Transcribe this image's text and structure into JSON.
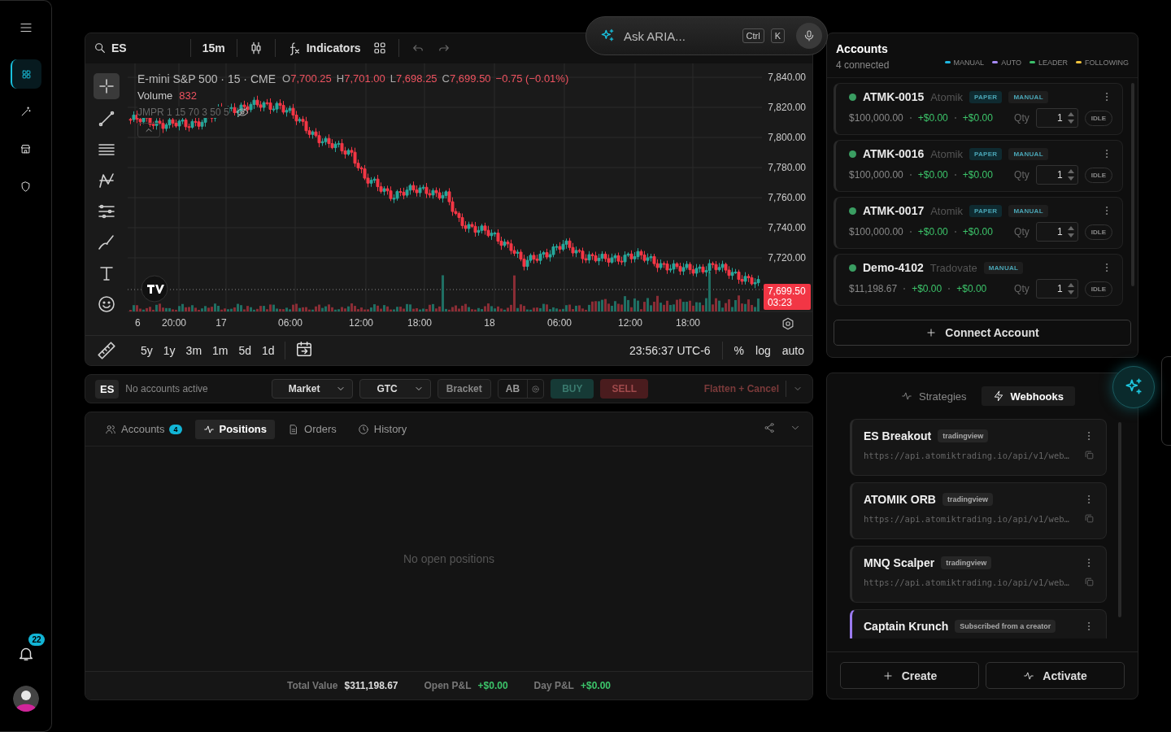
{
  "sidebar": {
    "items": [
      {
        "kind": "grid",
        "selected": true
      },
      {
        "kind": "wand",
        "selected": false
      },
      {
        "kind": "store",
        "selected": false
      },
      {
        "kind": "shield",
        "selected": false
      }
    ],
    "notifications": "22"
  },
  "aria": {
    "placeholder": "Ask ARIA...",
    "keys": [
      "Ctrl",
      "K"
    ]
  },
  "chart": {
    "symbol": "ES",
    "interval": "15m",
    "indicators": "Indicators",
    "title": "E-mini S&P 500 · 15 · CME",
    "ohlc": [
      {
        "label": "O",
        "value": "7,700.25"
      },
      {
        "label": "H",
        "value": "7,701.00"
      },
      {
        "label": "L",
        "value": "7,698.25"
      },
      {
        "label": "C",
        "value": "7,699.50"
      }
    ],
    "change": "−0.75 (−0.01%)",
    "volume_label": "Volume",
    "volume": "832",
    "indicator_legend": "JMPR 1 15 70 3 50 5",
    "price_ticks": [
      "7,840.00",
      "7,820.00",
      "7,800.00",
      "7,780.00",
      "7,760.00",
      "7,740.00",
      "7,720.00"
    ],
    "time_ticks": [
      "6",
      "20:00",
      "17",
      "06:00",
      "12:00",
      "18:00",
      "18",
      "06:00",
      "12:00",
      "18:00"
    ],
    "last_price": "7,699.50",
    "countdown": "03:23",
    "ranges": [
      "5y",
      "1y",
      "3m",
      "1m",
      "5d",
      "1d"
    ],
    "clock": "23:56:37 UTC-6",
    "scale_options": [
      "%",
      "log",
      "auto"
    ]
  },
  "order_bar": {
    "symbol": "ES",
    "status": "No accounts active",
    "order_type": "Market",
    "time_in_force": "GTC",
    "bracket": "Bracket",
    "ab": "AB",
    "buy": "BUY",
    "sell": "SELL",
    "flatten": "Flatten + Cancel"
  },
  "positions": {
    "tabs": [
      {
        "label": "Accounts",
        "kind": "users",
        "badge": "4",
        "selected": false
      },
      {
        "label": "Positions",
        "kind": "pulse",
        "selected": true
      },
      {
        "label": "Orders",
        "kind": "doc",
        "selected": false
      },
      {
        "label": "History",
        "kind": "clock",
        "selected": false
      }
    ],
    "empty": "No open positions",
    "totals": [
      {
        "label": "Total Value",
        "value": "$311,198.67",
        "kind": "plain"
      },
      {
        "label": "Open P&L",
        "value": "+$0.00",
        "kind": "gain"
      },
      {
        "label": "Day P&L",
        "value": "+$0.00",
        "kind": "gain"
      }
    ]
  },
  "accounts": {
    "title": "Accounts",
    "subtitle": "4 connected",
    "legend": [
      {
        "label": "MANUAL",
        "color": "#1fb6e0"
      },
      {
        "label": "AUTO",
        "color": "#a78bfa"
      },
      {
        "label": "LEADER",
        "color": "#3cbf6a"
      },
      {
        "label": "FOLLOWING",
        "color": "#f0c23c"
      }
    ],
    "items": [
      {
        "name": "ATMK-0015",
        "broker": "Atomik",
        "tags": [
          {
            "label": "PAPER",
            "kind": "paper"
          },
          {
            "label": "MANUAL",
            "kind": "mode"
          }
        ],
        "balance": "$100,000.00",
        "open_pnl": "+$0.00",
        "day_pnl": "+$0.00",
        "qty_label": "Qty",
        "qty": "1",
        "status": "IDLE"
      },
      {
        "name": "ATMK-0016",
        "broker": "Atomik",
        "tags": [
          {
            "label": "PAPER",
            "kind": "paper"
          },
          {
            "label": "MANUAL",
            "kind": "mode"
          }
        ],
        "balance": "$100,000.00",
        "open_pnl": "+$0.00",
        "day_pnl": "+$0.00",
        "qty_label": "Qty",
        "qty": "1",
        "status": "IDLE"
      },
      {
        "name": "ATMK-0017",
        "broker": "Atomik",
        "tags": [
          {
            "label": "PAPER",
            "kind": "paper"
          },
          {
            "label": "MANUAL",
            "kind": "mode"
          }
        ],
        "balance": "$100,000.00",
        "open_pnl": "+$0.00",
        "day_pnl": "+$0.00",
        "qty_label": "Qty",
        "qty": "1",
        "status": "IDLE"
      },
      {
        "name": "Demo-4102",
        "broker": "Tradovate",
        "tags": [
          {
            "label": "MANUAL",
            "kind": "mode"
          }
        ],
        "balance": "$11,198.67",
        "open_pnl": "+$0.00",
        "day_pnl": "+$0.00",
        "qty_label": "Qty",
        "qty": "1",
        "status": "IDLE"
      }
    ],
    "connect": "Connect Account"
  },
  "strategies": {
    "tabs": [
      {
        "label": "Strategies",
        "kind": "pulse",
        "selected": false
      },
      {
        "label": "Webhooks",
        "kind": "bolt",
        "selected": true
      }
    ],
    "items": [
      {
        "name": "ES Breakout",
        "tag": "tradingview",
        "url": "https://api.atomiktrading.io/api/v1/web…",
        "kind": "webhook"
      },
      {
        "name": "ATOMIK ORB",
        "tag": "tradingview",
        "url": "https://api.atomiktrading.io/api/v1/web…",
        "kind": "webhook"
      },
      {
        "name": "MNQ Scalper",
        "tag": "tradingview",
        "url": "https://api.atomiktrading.io/api/v1/web…",
        "kind": "webhook"
      },
      {
        "name": "Captain Krunch",
        "tag": "Subscribed from a creator",
        "kind": "subscribed"
      }
    ],
    "create": "Create",
    "activate": "Activate"
  }
}
